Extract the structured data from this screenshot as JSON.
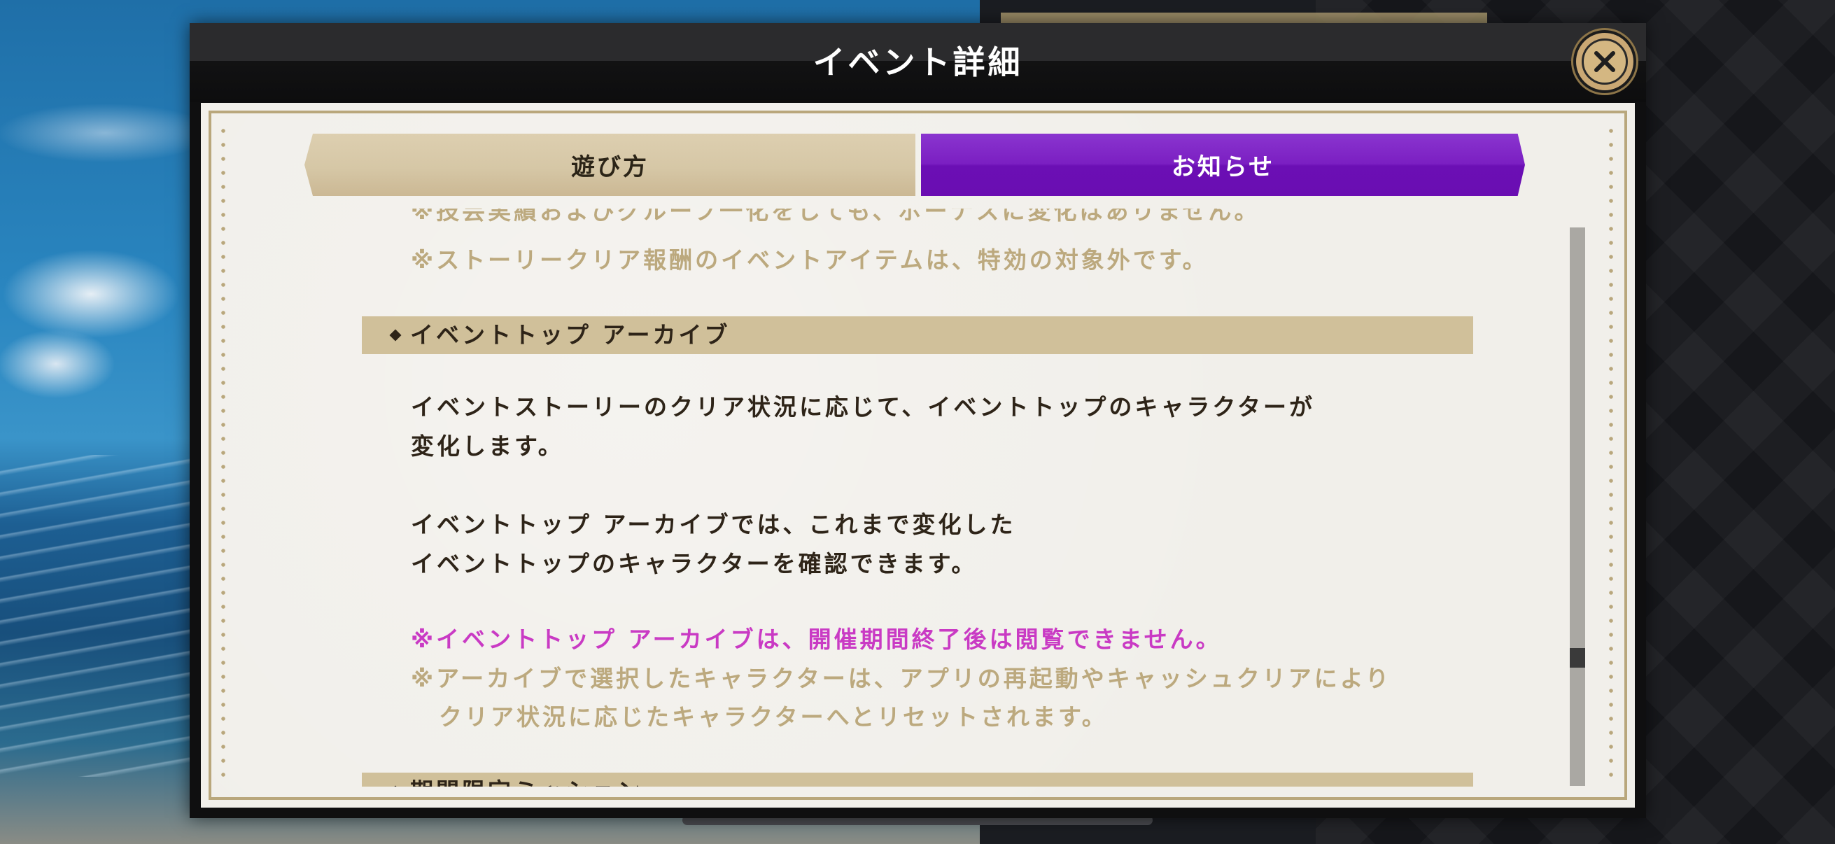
{
  "modal": {
    "title": "イベント詳細",
    "close_icon": "close-icon"
  },
  "tabs": [
    {
      "label": "遊び方",
      "active": false
    },
    {
      "label": "お知らせ",
      "active": true
    }
  ],
  "content": {
    "cut_top_line": "※技芸実績およびグループ一化をしても、ボーナスに変化はありません。",
    "note_story_reward": "※ストーリークリア報酬のイベントアイテムは、特効の対象外です。",
    "section_archive": {
      "heading": "イベントトップ アーカイブ",
      "paragraph1_line1": "イベントストーリーのクリア状況に応じて、イベントトップのキャラクターが",
      "paragraph1_line2": "変化します。",
      "paragraph2_line1": "イベントトップ アーカイブでは、これまで変化した",
      "paragraph2_line2": "イベントトップのキャラクターを確認できます。",
      "warning": "※イベントトップ アーカイブは、開催期間終了後は閲覧できません。",
      "note_line1": "※アーカイブで選択したキャラクターは、アプリの再起動やキャッシュクリアにより",
      "note_line2": "クリア状況に応じたキャラクターへとリセットされます。"
    },
    "section_next_heading": "期間限定ミッション"
  },
  "colors": {
    "active_tab": "#7b1fc2",
    "inactive_tab": "#d6c7a6",
    "accent_text": "#c93ac4",
    "muted_text": "#bca97e",
    "body_text": "#2e2418",
    "section_bar": "#d0c09a",
    "frame_gold": "#b9a77c"
  },
  "scrollbar": {
    "position_fraction": 0.76
  }
}
